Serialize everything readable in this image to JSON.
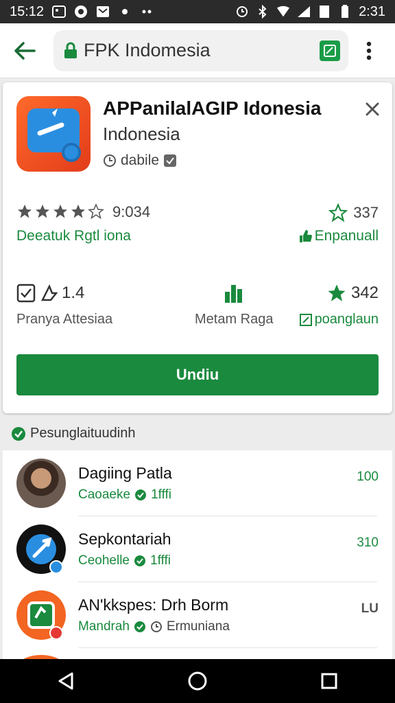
{
  "status_bar": {
    "time_left": "15:12",
    "time_right": "2:31"
  },
  "search": {
    "query": "FPK Indomesia"
  },
  "app": {
    "title": "APPanilalAGIP Idonesia",
    "subtitle": "Indonesia",
    "developer": "dabile",
    "rating_value": "9:034",
    "rating_label": "Deeatuk Rgtl iona",
    "right_count": "337",
    "right_label": "Enpanuall",
    "stat1_value": "1.4",
    "stat1_label": "Pranya Attesiaa",
    "stat2_label": "Metam Raga",
    "stat3_value": "342",
    "stat3_label": "poanglaun",
    "install_label": "Undiu"
  },
  "section": {
    "heading": "Pesunglaituudinh"
  },
  "list": [
    {
      "name": "Dagiing Patla",
      "meta": "Caoaeke",
      "meta2": "1fffi",
      "num": "100"
    },
    {
      "name": "Sepkontariah",
      "meta": "Ceohelle",
      "meta2": "1fffi",
      "num": "310"
    },
    {
      "name": "AN'kkspes: Drh Borm",
      "meta": "Mandrah",
      "meta2": "Ermuniana",
      "num": "LU"
    }
  ],
  "colors": {
    "accent": "#1a8a3e",
    "status_bar": "#2b2b2b"
  }
}
